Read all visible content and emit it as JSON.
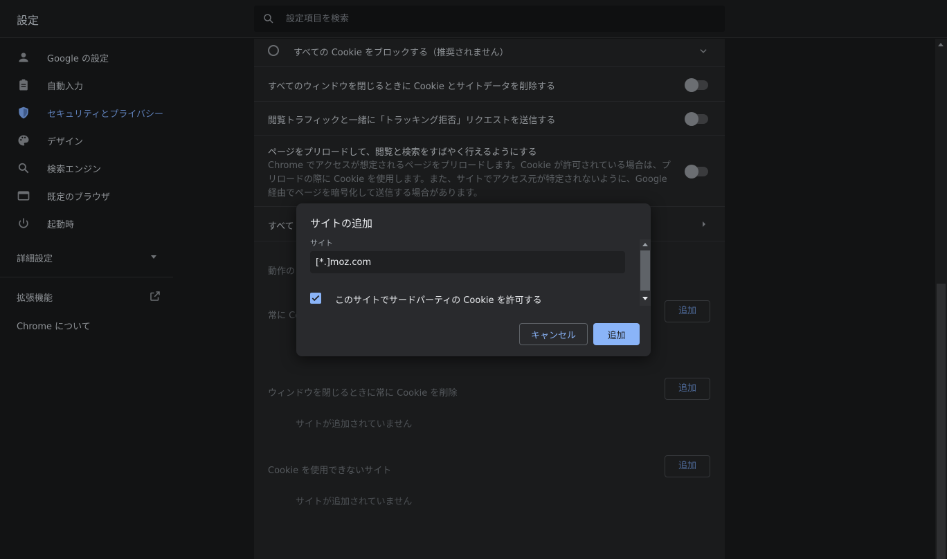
{
  "header": {
    "title": "設定",
    "search_placeholder": "設定項目を検索"
  },
  "sidebar": {
    "items": [
      {
        "label": "Google の設定",
        "icon": "person-icon"
      },
      {
        "label": "自動入力",
        "icon": "clipboard-icon"
      },
      {
        "label": "セキュリティとプライバシー",
        "icon": "shield-icon",
        "active": true
      },
      {
        "label": "デザイン",
        "icon": "palette-icon"
      },
      {
        "label": "検索エンジン",
        "icon": "search-icon"
      },
      {
        "label": "既定のブラウザ",
        "icon": "browser-window-icon"
      },
      {
        "label": "起動時",
        "icon": "power-icon"
      }
    ],
    "advanced": "詳細設定",
    "extensions": "拡張機能",
    "about": "Chrome について"
  },
  "content": {
    "block_all": "すべての Cookie をブロックする（推奨されません）",
    "clear_on_close": "すべてのウィンドウを閉じるときに Cookie とサイトデータを削除する",
    "do_not_track": "閲覧トラフィックと一緒に「トラッキング拒否」リクエストを送信する",
    "preload_title": "ページをプリロードして、閲覧と検索をすばやく行えるようにする",
    "preload_desc": "Chrome でアクセスが想定されるページをプリロードします。Cookie が許可されている場合は、プリロードの際に Cookie を使用します。また、サイトでアクセス元が特定されないように、Google 経由でページを暗号化して送信する場合があります。",
    "see_all_partial": "すべて",
    "behavior_partial": "動作の",
    "always_allow_partial": "常に Co",
    "clear_on_close_sites": "ウィンドウを閉じるときに常に Cookie を削除",
    "never_sites": "Cookie を使用できないサイト",
    "no_sites": "サイトが追加されていません",
    "add_label": "追加"
  },
  "dialog": {
    "title": "サイトの追加",
    "site_label": "サイト",
    "site_value": "[*.]moz.com",
    "checkbox_label": "このサイトでサードパーティの Cookie を許可する",
    "checkbox_checked": true,
    "cancel": "キャンセル",
    "add": "追加"
  },
  "colors": {
    "accent": "#8ab4f8",
    "active_nav": "#5e7fb8",
    "dialog_bg": "#292a2d"
  }
}
